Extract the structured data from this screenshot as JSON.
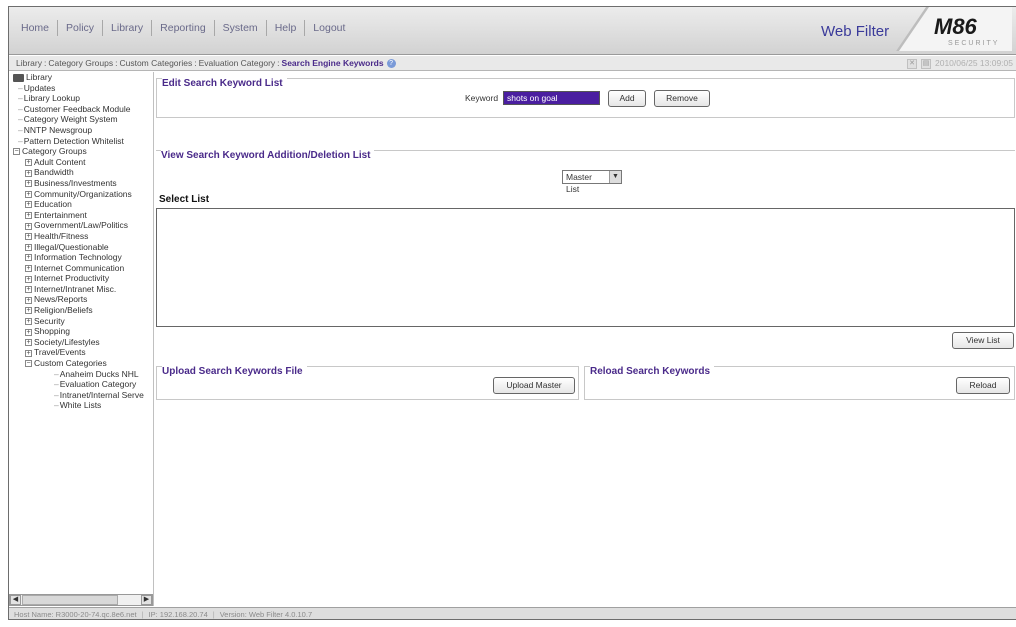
{
  "menu": [
    "Home",
    "Policy",
    "Library",
    "Reporting",
    "System",
    "Help",
    "Logout"
  ],
  "product_name": "Web Filter",
  "logo": {
    "main": "M86",
    "sub": "SECURITY"
  },
  "breadcrumb": {
    "items": [
      "Library",
      "Category Groups",
      "Custom Categories",
      "Evaluation Category"
    ],
    "current": "Search Engine Keywords",
    "datetime": "2010/06/25 13:09:05"
  },
  "tree": [
    {
      "label": "Library",
      "level": 0,
      "type": "root"
    },
    {
      "label": "Updates",
      "level": 1,
      "type": "leaf"
    },
    {
      "label": "Library Lookup",
      "level": 1,
      "type": "leaf"
    },
    {
      "label": "Customer Feedback Module",
      "level": 1,
      "type": "leaf"
    },
    {
      "label": "Category Weight System",
      "level": 1,
      "type": "leaf"
    },
    {
      "label": "NNTP Newsgroup",
      "level": 1,
      "type": "leaf"
    },
    {
      "label": "Pattern Detection Whitelist",
      "level": 1,
      "type": "leaf"
    },
    {
      "label": "Category Groups",
      "level": 0,
      "type": "expanded"
    },
    {
      "label": "Adult Content",
      "level": 2,
      "type": "collapsed"
    },
    {
      "label": "Bandwidth",
      "level": 2,
      "type": "collapsed"
    },
    {
      "label": "Business/Investments",
      "level": 2,
      "type": "collapsed"
    },
    {
      "label": "Community/Organizations",
      "level": 2,
      "type": "collapsed"
    },
    {
      "label": "Education",
      "level": 2,
      "type": "collapsed"
    },
    {
      "label": "Entertainment",
      "level": 2,
      "type": "collapsed"
    },
    {
      "label": "Government/Law/Politics",
      "level": 2,
      "type": "collapsed"
    },
    {
      "label": "Health/Fitness",
      "level": 2,
      "type": "collapsed"
    },
    {
      "label": "Illegal/Questionable",
      "level": 2,
      "type": "collapsed"
    },
    {
      "label": "Information Technology",
      "level": 2,
      "type": "collapsed"
    },
    {
      "label": "Internet Communication",
      "level": 2,
      "type": "collapsed"
    },
    {
      "label": "Internet Productivity",
      "level": 2,
      "type": "collapsed"
    },
    {
      "label": "Internet/Intranet Misc.",
      "level": 2,
      "type": "collapsed"
    },
    {
      "label": "News/Reports",
      "level": 2,
      "type": "collapsed"
    },
    {
      "label": "Religion/Beliefs",
      "level": 2,
      "type": "collapsed"
    },
    {
      "label": "Security",
      "level": 2,
      "type": "collapsed"
    },
    {
      "label": "Shopping",
      "level": 2,
      "type": "collapsed"
    },
    {
      "label": "Society/Lifestyles",
      "level": 2,
      "type": "collapsed"
    },
    {
      "label": "Travel/Events",
      "level": 2,
      "type": "collapsed"
    },
    {
      "label": "Custom Categories",
      "level": 2,
      "type": "expanded"
    },
    {
      "label": "Anaheim Ducks NHL",
      "level": 3,
      "type": "leaf"
    },
    {
      "label": "Evaluation Category",
      "level": 3,
      "type": "leaf"
    },
    {
      "label": "Intranet/Internal Serve",
      "level": 3,
      "type": "leaf"
    },
    {
      "label": "White Lists",
      "level": 3,
      "type": "leaf"
    }
  ],
  "edit_section": {
    "title": "Edit Search Keyword List",
    "keyword_label": "Keyword",
    "keyword_value": "shots on goal",
    "add_label": "Add",
    "remove_label": "Remove"
  },
  "view_section": {
    "title": "View Search Keyword Addition/Deletion List",
    "list_select": "Master List",
    "select_list_label": "Select List",
    "view_list_label": "View List"
  },
  "upload_section": {
    "title": "Upload Search Keywords File",
    "button_label": "Upload Master"
  },
  "reload_section": {
    "title": "Reload Search Keywords",
    "button_label": "Reload"
  },
  "status": {
    "host": "Host Name: R3000-20-74.qc.8e6.net",
    "ip": "IP: 192.168.20.74",
    "version": "Version: Web Filter 4.0.10.7"
  },
  "colors": {
    "accent": "#4a2a8a",
    "keyword_field": "#4a1ea0",
    "product_name": "#3a3a9a"
  }
}
